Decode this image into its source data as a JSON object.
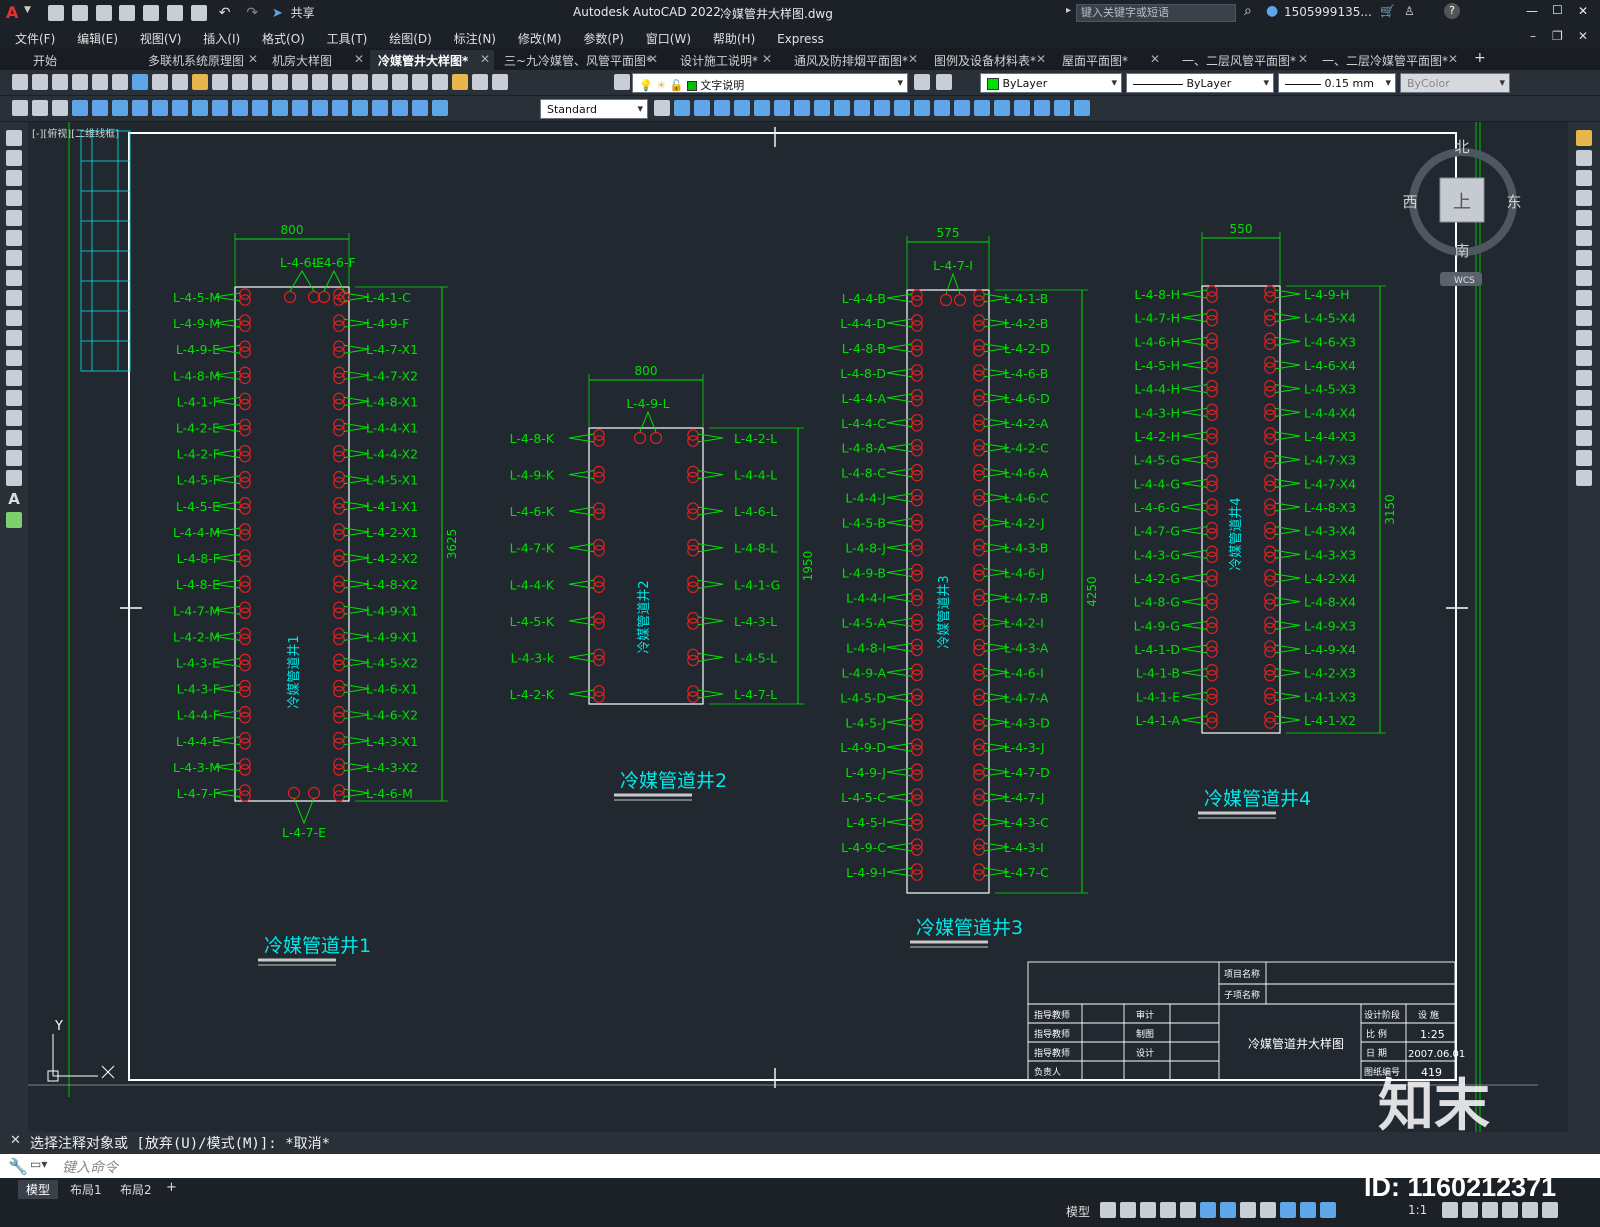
{
  "titlebar": {
    "app_title": "Autodesk AutoCAD 2022",
    "file_name": "冷媒管井大样图.dwg",
    "share_label": "共享",
    "search_placeholder": "键入关键字或短语",
    "user": "1505999135...",
    "win_min": "—",
    "win_max": "☐",
    "win_close": "✕"
  },
  "menu": [
    "文件(F)",
    "编辑(E)",
    "视图(V)",
    "插入(I)",
    "格式(O)",
    "工具(T)",
    "绘图(D)",
    "标注(N)",
    "修改(M)",
    "参数(P)",
    "窗口(W)",
    "帮助(H)",
    "Express"
  ],
  "tabs": [
    {
      "label": "开始",
      "active": false
    },
    {
      "label": "多联机系统原理图",
      "active": false
    },
    {
      "label": "机房大样图",
      "active": false
    },
    {
      "label": "冷媒管井大样图*",
      "active": true
    },
    {
      "label": "三~九冷媒管、风管平面图*",
      "active": false
    },
    {
      "label": "设计施工说明*",
      "active": false
    },
    {
      "label": "通风及防排烟平面图*",
      "active": false
    },
    {
      "label": "图例及设备材料表*",
      "active": false
    },
    {
      "label": "屋面平面图*",
      "active": false
    },
    {
      "label": "一、二层风管平面图*",
      "active": false
    },
    {
      "label": "一、二层冷媒管平面图*",
      "active": false
    }
  ],
  "tab_add": "+",
  "toolbar": {
    "layer": "文字说明",
    "color": "ByLayer",
    "linetype": "ByLayer",
    "lineweight": "0.15 mm",
    "plotstyle": "ByColor",
    "textstyle": "Standard"
  },
  "viewport_label": "[-][俯视][二维线框]",
  "viewcube": {
    "north": "北",
    "south": "南",
    "east": "东",
    "west": "西",
    "top": "上",
    "wcs": "WCS"
  },
  "ucs": {
    "y": "Y",
    "x": "X"
  },
  "colors": {
    "green": "#00e000",
    "red": "#e02020",
    "cyan": "#00e8e8",
    "white": "#ffffff"
  },
  "shafts": [
    {
      "title": "冷媒管道井1",
      "inner": "冷媒管道井1",
      "width_dim": "800",
      "height_dim": "3625",
      "top_labels": [
        "L-4-6-E",
        "L-4-6-F"
      ],
      "bottom_labels": [
        "L-4-7-E"
      ],
      "left": [
        "L-4-5-M",
        "L-4-9-M",
        "L-4-9-E",
        "L-4-8-M",
        "L-4-1-F",
        "L-4-2-E",
        "L-4-2-F",
        "L-4-5-F",
        "L-4-5-E",
        "L-4-4-M",
        "L-4-8-F",
        "L-4-8-E",
        "L-4-7-M",
        "L-4-2-M",
        "L-4-3-E",
        "L-4-3-F",
        "L-4-4-F",
        "L-4-4-E",
        "L-4-3-M",
        "L-4-7-F"
      ],
      "right": [
        "L-4-1-C",
        "L-4-9-F",
        "L-4-7-X1",
        "L-4-7-X2",
        "L-4-8-X1",
        "L-4-4-X1",
        "L-4-4-X2",
        "L-4-5-X1",
        "L-4-1-X1",
        "L-4-2-X1",
        "L-4-2-X2",
        "L-4-8-X2",
        "L-4-9-X1",
        "L-4-9-X1",
        "L-4-5-X2",
        "L-4-6-X1",
        "L-4-6-X2",
        "L-4-3-X1",
        "L-4-3-X2",
        "L-4-6-M"
      ]
    },
    {
      "title": "冷媒管道井2",
      "inner": "冷媒管道井2",
      "width_dim": "800",
      "height_dim": "1950",
      "top_labels": [
        "L-4-9-L"
      ],
      "bottom_labels": [],
      "left": [
        "L-4-8-K",
        "L-4-9-K",
        "L-4-6-K",
        "L-4-7-K",
        "L-4-4-K",
        "L-4-5-K",
        "L-4-3-k",
        "L-4-2-K"
      ],
      "right": [
        "L-4-2-L",
        "L-4-4-L",
        "L-4-6-L",
        "L-4-8-L",
        "L-4-1-G",
        "L-4-3-L",
        "L-4-5-L",
        "L-4-7-L"
      ]
    },
    {
      "title": "冷媒管道井3",
      "inner": "冷媒管道井3",
      "width_dim": "575",
      "height_dim": "4250",
      "top_labels": [
        "L-4-7-I"
      ],
      "bottom_labels": [],
      "left": [
        "L-4-4-B",
        "L-4-4-D",
        "L-4-8-B",
        "L-4-8-D",
        "L-4-4-A",
        "L-4-4-C",
        "L-4-8-A",
        "L-4-8-C",
        "L-4-4-J",
        "L-4-5-B",
        "L-4-8-J",
        "L-4-9-B",
        "L-4-4-I",
        "L-4-5-A",
        "L-4-8-I",
        "L-4-9-A",
        "L-4-5-D",
        "L-4-5-J",
        "L-4-9-D",
        "L-4-9-J",
        "L-4-5-C",
        "L-4-5-I",
        "L-4-9-C",
        "L-4-9-I"
      ],
      "right": [
        "L-4-1-B",
        "L-4-2-B",
        "L-4-2-D",
        "L-4-6-B",
        "L-4-6-D",
        "L-4-2-A",
        "L-4-2-C",
        "L-4-6-A",
        "L-4-6-C",
        "L-4-2-J",
        "L-4-3-B",
        "L-4-6-J",
        "L-4-7-B",
        "L-4-2-I",
        "L-4-3-A",
        "L-4-6-I",
        "L-4-7-A",
        "L-4-3-D",
        "L-4-3-J",
        "L-4-7-D",
        "L-4-7-J",
        "L-4-3-C",
        "L-4-3-I",
        "L-4-7-C"
      ]
    },
    {
      "title": "冷媒管道井4",
      "inner": "冷媒管道井4",
      "width_dim": "550",
      "height_dim": "3150",
      "top_labels": [],
      "bottom_labels": [],
      "left": [
        "L-4-8-H",
        "L-4-7-H",
        "L-4-6-H",
        "L-4-5-H",
        "L-4-4-H",
        "L-4-3-H",
        "L-4-2-H",
        "L-4-5-G",
        "L-4-4-G",
        "L-4-6-G",
        "L-4-7-G",
        "L-4-3-G",
        "L-4-2-G",
        "L-4-8-G",
        "L-4-9-G",
        "L-4-1-D",
        "L-4-1-B",
        "L-4-1-E",
        "L-4-1-A"
      ],
      "right": [
        "L-4-9-H",
        "L-4-5-X4",
        "L-4-6-X3",
        "L-4-6-X4",
        "L-4-5-X3",
        "L-4-4-X4",
        "L-4-4-X3",
        "L-4-7-X3",
        "L-4-7-X4",
        "L-4-8-X3",
        "L-4-3-X4",
        "L-4-3-X3",
        "L-4-2-X4",
        "L-4-8-X4",
        "L-4-9-X3",
        "L-4-9-X4",
        "L-4-2-X3",
        "L-4-1-X3",
        "L-4-1-X2"
      ]
    }
  ],
  "titleblock": {
    "project_name": "项目名称",
    "sub_name": "子项名称",
    "design_stage": "设计阶段",
    "stage_value": "设 施",
    "scale_label": "比 例",
    "scale_value": "1:25",
    "date_label": "日 期",
    "date_value": "2007.06.01",
    "sheet_label": "图纸编号",
    "sheet_value": "419",
    "drawing_title": "冷媒管道井大样图",
    "r1a": "指导教师",
    "r1b": "审计",
    "r2a": "指导教师",
    "r2b": "制图",
    "r3a": "指导教师",
    "r3b": "设计",
    "r4a": "负责人"
  },
  "command": {
    "history": "选择注释对象或 [放弃(U)/模式(M)]: *取消*",
    "placeholder": "键入命令"
  },
  "layouts": [
    "模型",
    "布局1",
    "布局2"
  ],
  "layout_add": "+",
  "statusbar": {
    "model": "模型",
    "scale": "1:1"
  },
  "watermark": {
    "brand": "知末",
    "id": "ID: 1160212371"
  }
}
